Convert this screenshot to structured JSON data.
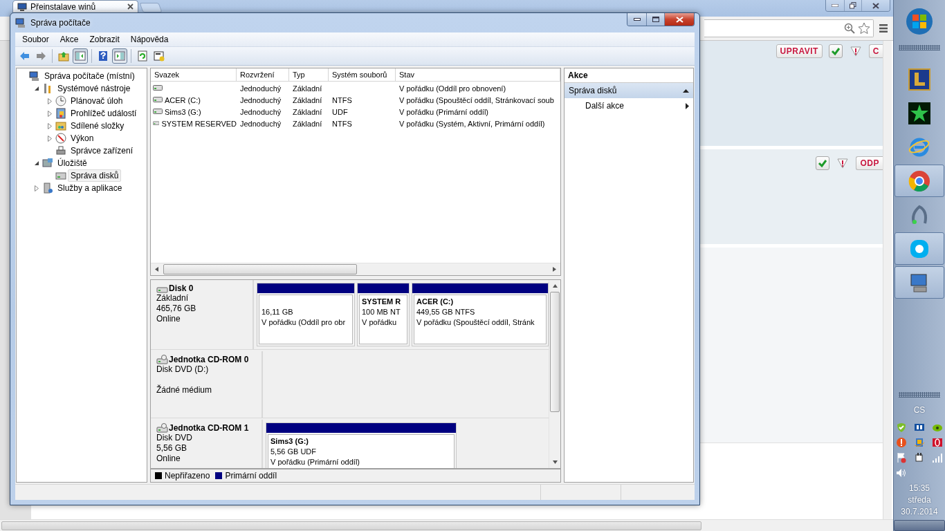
{
  "browser": {
    "tab": {
      "title": "Přeinstalave winů"
    },
    "posts": [
      {
        "buttons": [
          {
            "kind": "edit",
            "label": "UPRAVIT"
          },
          {
            "kind": "approve"
          },
          {
            "kind": "report"
          },
          {
            "kind": "quote",
            "label": "C"
          }
        ]
      },
      {
        "buttons": [
          {
            "kind": "approve"
          },
          {
            "kind": "report"
          },
          {
            "kind": "reply",
            "label": "ODP"
          }
        ]
      }
    ]
  },
  "window": {
    "title": "Správa počítače",
    "menu": [
      "Soubor",
      "Akce",
      "Zobrazit",
      "Nápověda"
    ],
    "toolbar": [
      {
        "kind": "back",
        "pressed": false
      },
      {
        "kind": "forward",
        "pressed": false
      },
      {
        "kind": "up",
        "pressed": false
      },
      {
        "kind": "console_tree",
        "pressed": true
      },
      {
        "kind": "help",
        "pressed": false
      },
      {
        "kind": "action_pane",
        "pressed": true
      },
      {
        "kind": "refresh",
        "pressed": false
      },
      {
        "kind": "properties",
        "pressed": false
      }
    ],
    "tree": [
      {
        "label": "Správa počítače (místní)",
        "selected": false,
        "children": [
          {
            "label": "Systémové nástroje",
            "expanded": true,
            "selected": false,
            "children": [
              {
                "label": "Plánovač úloh",
                "expanded": false,
                "selected": false
              },
              {
                "label": "Prohlížeč událostí",
                "expanded": false,
                "selected": false
              },
              {
                "label": "Sdílené složky",
                "expanded": false,
                "selected": false
              },
              {
                "label": "Výkon",
                "expanded": false,
                "selected": false
              },
              {
                "label": "Správce zařízení",
                "selected": false
              }
            ]
          },
          {
            "label": "Úložiště",
            "expanded": true,
            "selected": false,
            "children": [
              {
                "label": "Správa disků",
                "selected": true
              }
            ]
          },
          {
            "label": "Služby a aplikace",
            "expanded": false,
            "selected": false
          }
        ]
      }
    ],
    "table": {
      "columns": [
        "Svazek",
        "Rozvržení",
        "Typ",
        "Systém souborů",
        "Stav"
      ],
      "rows": [
        {
          "layout": "Jednoduchý",
          "type": "Základní",
          "status": "V pořádku (Oddíl pro obnovení)"
        },
        {
          "volume": "ACER (C:)",
          "layout": "Jednoduchý",
          "type": "Základní",
          "fs": "NTFS",
          "status": "V pořádku (Spouštěcí oddíl, Stránkovací soub"
        },
        {
          "volume": "Sims3 (G:)",
          "layout": "Jednoduchý",
          "type": "Základní",
          "fs": "UDF",
          "status": "V pořádku (Primární oddíl)"
        },
        {
          "volume": "SYSTEM RESERVED",
          "layout": "Jednoduchý",
          "type": "Základní",
          "fs": "NTFS",
          "status": "V pořádku (Systém, Aktivní, Primární oddíl)"
        }
      ]
    },
    "disks": [
      {
        "kind": "hdd",
        "name": "Disk 0",
        "info": [
          "Základní",
          "465,76 GB",
          "Online"
        ],
        "partitions": [
          {
            "kind": "primary",
            "size": "16,11 GB",
            "status": "V pořádku (Oddíl pro obr"
          },
          {
            "kind": "primary",
            "title": "SYSTEM R",
            "size": "100 MB NT",
            "status": "V pořádku"
          },
          {
            "kind": "primary",
            "title": "ACER  (C:)",
            "size": "449,55 GB NTFS",
            "status": "V pořádku (Spouštěcí oddíl, Stránk"
          }
        ]
      },
      {
        "kind": "cdrom",
        "name": "Jednotka CD-ROM 0",
        "info": [
          "Disk DVD (D:)"
        ],
        "note": "Žádné médium"
      },
      {
        "kind": "cdrom",
        "name": "Jednotka CD-ROM 1",
        "info": [
          "Disk DVD",
          "5,56 GB",
          "Online"
        ],
        "partitions": [
          {
            "kind": "primary",
            "title": "Sims3  (G:)",
            "size": "5,56 GB UDF",
            "status": "V pořádku (Primární oddíl)"
          }
        ]
      }
    ],
    "legend": [
      {
        "label": "Nepřiřazeno",
        "color": "#000000"
      },
      {
        "label": "Primární oddíl",
        "color": "#000080"
      }
    ],
    "actions": {
      "title": "Akce",
      "sections": [
        {
          "title": "Správa disků",
          "expanded": true,
          "items": [
            "Další akce"
          ]
        }
      ]
    }
  },
  "taskbar": {
    "apps": [
      {
        "running": false
      },
      {
        "running": false
      },
      {
        "running": false
      },
      {
        "running": false
      },
      {
        "running": true
      },
      {
        "running": false
      },
      {
        "running": true
      },
      {
        "running": true
      }
    ],
    "language": "CS",
    "time": "15:35",
    "day": "středa",
    "date": "30.7.2014"
  }
}
